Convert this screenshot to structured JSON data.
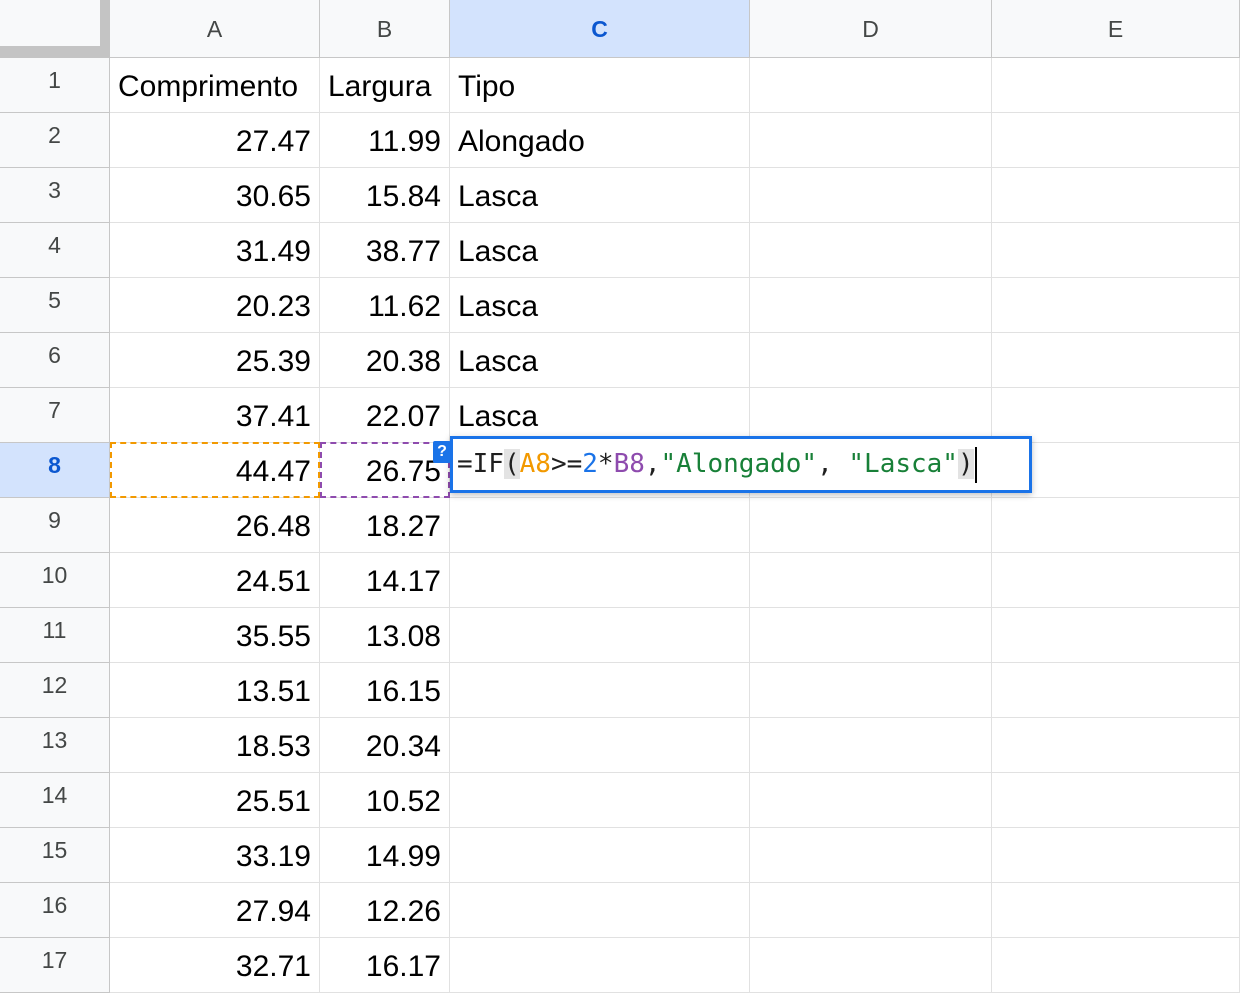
{
  "columns": [
    "A",
    "B",
    "C",
    "D",
    "E"
  ],
  "selected_column": "C",
  "selected_row": "8",
  "rows": [
    {
      "num": "1",
      "cells": [
        "Comprimento",
        "Largura",
        "Tipo",
        "",
        ""
      ]
    },
    {
      "num": "2",
      "cells": [
        "27.47",
        "11.99",
        "Alongado",
        "",
        ""
      ]
    },
    {
      "num": "3",
      "cells": [
        "30.65",
        "15.84",
        "Lasca",
        "",
        ""
      ]
    },
    {
      "num": "4",
      "cells": [
        "31.49",
        "38.77",
        "Lasca",
        "",
        ""
      ]
    },
    {
      "num": "5",
      "cells": [
        "20.23",
        "11.62",
        "Lasca",
        "",
        ""
      ]
    },
    {
      "num": "6",
      "cells": [
        "25.39",
        "20.38",
        "Lasca",
        "",
        ""
      ]
    },
    {
      "num": "7",
      "cells": [
        "37.41",
        "22.07",
        "Lasca",
        "",
        ""
      ]
    },
    {
      "num": "8",
      "cells": [
        "44.47",
        "26.75",
        "",
        "",
        ""
      ]
    },
    {
      "num": "9",
      "cells": [
        "26.48",
        "18.27",
        "",
        "",
        ""
      ]
    },
    {
      "num": "10",
      "cells": [
        "24.51",
        "14.17",
        "",
        "",
        ""
      ]
    },
    {
      "num": "11",
      "cells": [
        "35.55",
        "13.08",
        "",
        "",
        ""
      ]
    },
    {
      "num": "12",
      "cells": [
        "13.51",
        "16.15",
        "",
        "",
        ""
      ]
    },
    {
      "num": "13",
      "cells": [
        "18.53",
        "20.34",
        "",
        "",
        ""
      ]
    },
    {
      "num": "14",
      "cells": [
        "25.51",
        "10.52",
        "",
        "",
        ""
      ]
    },
    {
      "num": "15",
      "cells": [
        "33.19",
        "14.99",
        "",
        "",
        ""
      ]
    },
    {
      "num": "16",
      "cells": [
        "27.94",
        "12.26",
        "",
        "",
        ""
      ]
    },
    {
      "num": "17",
      "cells": [
        "32.71",
        "16.17",
        "",
        "",
        ""
      ]
    }
  ],
  "editor": {
    "tokens": [
      {
        "t": "=IF",
        "k": "op"
      },
      {
        "t": "(",
        "k": "paren"
      },
      {
        "t": "A8",
        "k": "ref-a"
      },
      {
        "t": ">=",
        "k": "op"
      },
      {
        "t": "2",
        "k": "num"
      },
      {
        "t": "*",
        "k": "op"
      },
      {
        "t": "B8",
        "k": "ref-b"
      },
      {
        "t": ",",
        "k": "op"
      },
      {
        "t": "\"Alongado\"",
        "k": "str"
      },
      {
        "t": ", ",
        "k": "op"
      },
      {
        "t": "\"Lasca\"",
        "k": "str"
      },
      {
        "t": ")",
        "k": "paren"
      }
    ],
    "help_icon": "?"
  },
  "colors": {
    "ref_a": "#f29900",
    "ref_b": "#8e4bae",
    "selection": "#1a73e8",
    "header_selected_bg": "#d3e3fd"
  }
}
